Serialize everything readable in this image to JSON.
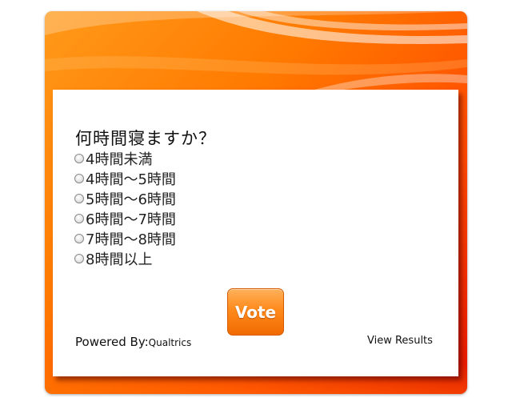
{
  "poll": {
    "question": "何時間寝ますか？",
    "options": [
      {
        "label": "4時間未満",
        "selected": false
      },
      {
        "label": "4時間～5時間",
        "selected": false
      },
      {
        "label": "5時間～6時間",
        "selected": false
      },
      {
        "label": "6時間～7時間",
        "selected": false
      },
      {
        "label": "7時間～8時間",
        "selected": false
      },
      {
        "label": "8時間以上",
        "selected": false
      }
    ],
    "vote_label": "Vote",
    "powered_by_label": "Powered By:",
    "powered_by_brand": "Qualtrics",
    "view_results_label": "View Results"
  },
  "colors": {
    "accent_orange": "#ff7a00",
    "accent_red": "#e81500",
    "button_orange": "#f78010"
  }
}
